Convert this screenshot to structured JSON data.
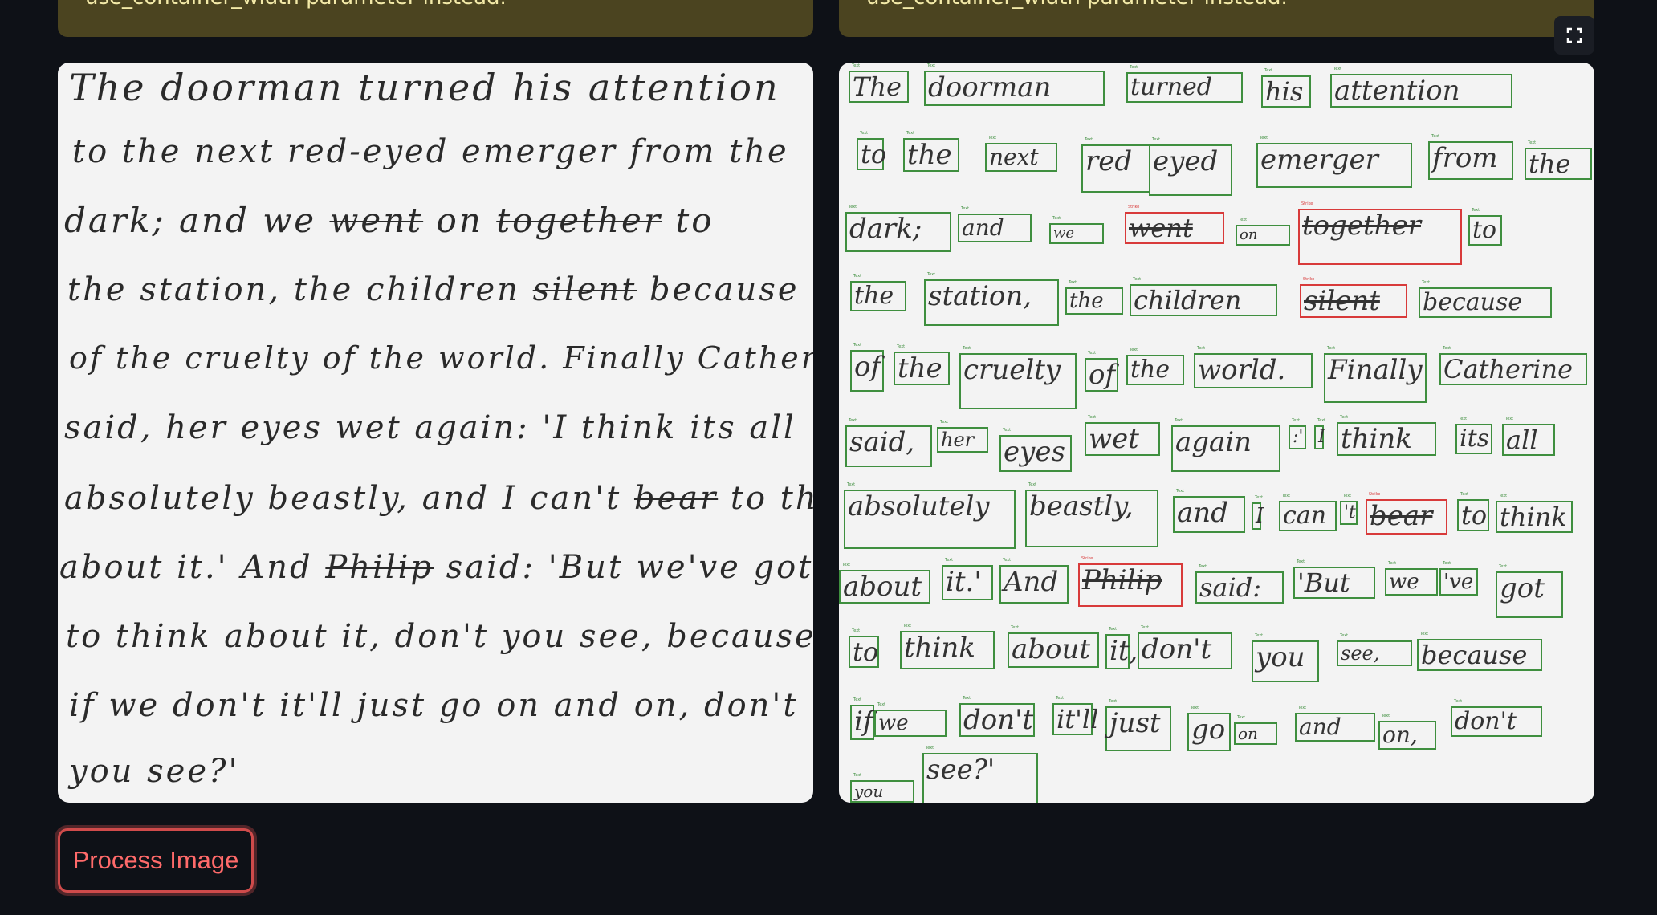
{
  "warnings": {
    "left_text": "use_container_width parameter instead.",
    "right_text": "use_container_width parameter instead."
  },
  "original_image": {
    "lines": [
      "The doorman turned his attention",
      "to the next red-eyed emerger from the",
      "dark; and we went on together to",
      "the station, the children silent because",
      "of the cruelty of the world. Finally Catherine",
      "said, her eyes wet again: 'I think its all",
      "absolutely beastly, and I can't bear to think",
      "about it.' And Philip said: 'But we've got",
      "to think about it, don't you see, because",
      "if we don't it'll just go on and on, don't",
      "you see?'"
    ]
  },
  "annotated_image": {
    "label_text": "Text",
    "label_strike": "Strike",
    "words": [
      "The",
      "doorman",
      "turned",
      "his",
      "attention",
      "to",
      "the",
      "next",
      "red",
      "eyed",
      "emerger",
      "from",
      "the",
      "dark;",
      "and",
      "we",
      "went",
      "on",
      "together",
      "to",
      "the",
      "station,",
      "the",
      "children",
      "silent",
      "because",
      "of",
      "the",
      "cruelty",
      "of",
      "the",
      "world.",
      "Finally",
      "Catherine",
      "said,",
      "her",
      "eyes",
      "wet",
      "again",
      ":'",
      "I",
      "think",
      "its",
      "all",
      "absolutely",
      "beastly,",
      "and",
      "I",
      "can",
      "'t",
      "bear",
      "to",
      "think",
      "about",
      "it.'",
      "And",
      "Philip",
      "said:",
      "'But",
      "we",
      "'ve",
      "got",
      "to",
      "think",
      "about",
      "it,",
      "don't",
      "you",
      "see,",
      "because",
      "if",
      "we",
      "don't",
      "it'll",
      "just",
      "go",
      "on",
      "and",
      "on,",
      "don't",
      "you",
      "see?'"
    ]
  },
  "controls": {
    "process_button_label": "Process Image",
    "fullscreen_icon": "fullscreen-icon"
  },
  "colors": {
    "background": "#0e1117",
    "warning_bg": "#4b4420",
    "box_text": "#3f8f3f",
    "box_strike": "#d83a3a",
    "button_accent": "#ff6a6a"
  }
}
